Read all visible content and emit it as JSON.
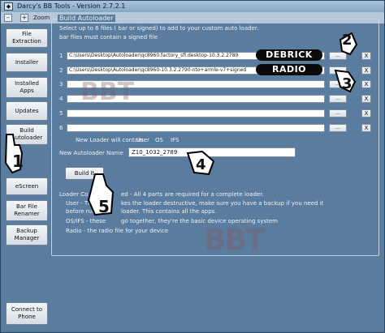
{
  "window": {
    "title": "Darcy's BB Tools - Version 2.7.2.1",
    "app_icon": "app-icon"
  },
  "toolbar": {
    "minus": "–",
    "plus": "+",
    "zoom_label": "Zoom"
  },
  "sidebar": {
    "items": [
      {
        "label": "File Extraction"
      },
      {
        "label": "Installer"
      },
      {
        "label": "Installed Apps"
      },
      {
        "label": "Updates"
      },
      {
        "label": "Build Autoloader"
      },
      {
        "label": "eScreen"
      },
      {
        "label": "Bar File Renamer"
      },
      {
        "label": "Backup Manager"
      },
      {
        "label": "Connect to Phone"
      }
    ]
  },
  "builder": {
    "group_title": "Build Autoloader",
    "instructions_1": "Select up to 6 files ( bar or  signed) to add to your custom auto loader.",
    "instructions_2": "bar files must contain a signed file",
    "rows": [
      {
        "num": "1",
        "path": "C:\\Users\\Desktop\\Autoloader\\qc8960.factory_sfi.desktop-10.3.2.2789",
        "browse": "...",
        "remove": "X"
      },
      {
        "num": "2",
        "path": "C:\\Users\\Desktop\\Autoloader\\qc8960-10.3.2.2790-nto+armle-v7+signed",
        "browse": "...",
        "remove": "X"
      },
      {
        "num": "3",
        "path": "",
        "browse": "...",
        "remove": "X"
      },
      {
        "num": "4",
        "path": "",
        "browse": "...",
        "remove": "X"
      },
      {
        "num": "5",
        "path": "",
        "browse": "...",
        "remove": "X"
      },
      {
        "num": "6",
        "path": "",
        "browse": "...",
        "remove": "X"
      }
    ],
    "contains_label": "New Loader will contain:",
    "contains_user": "User",
    "contains_os": "OS",
    "contains_ifs": "IFS",
    "name_label": "New Autoloader Name",
    "name_value": "Z10_1032_2789",
    "build_button": "Build It",
    "info_1": "Loader Co",
    "info_1b": "ed - All 4 parts are required for a complete loader.",
    "info_2": "User - Th",
    "info_2b": "kes the loader destructive, make sure you have a backup if you need it",
    "info_3": "before run",
    "info_3b": "loader.  This contains all the apps.",
    "info_4": "OS/IFS - these",
    "info_4b": "go together, they're the basic device operating system",
    "info_5": "Radio - the radio file for your device"
  },
  "annotations": {
    "debrick": "DEBRICK",
    "radio": "RADIO",
    "steps": [
      "1",
      "2",
      "3",
      "4",
      "5"
    ],
    "watermark": "BBT"
  }
}
